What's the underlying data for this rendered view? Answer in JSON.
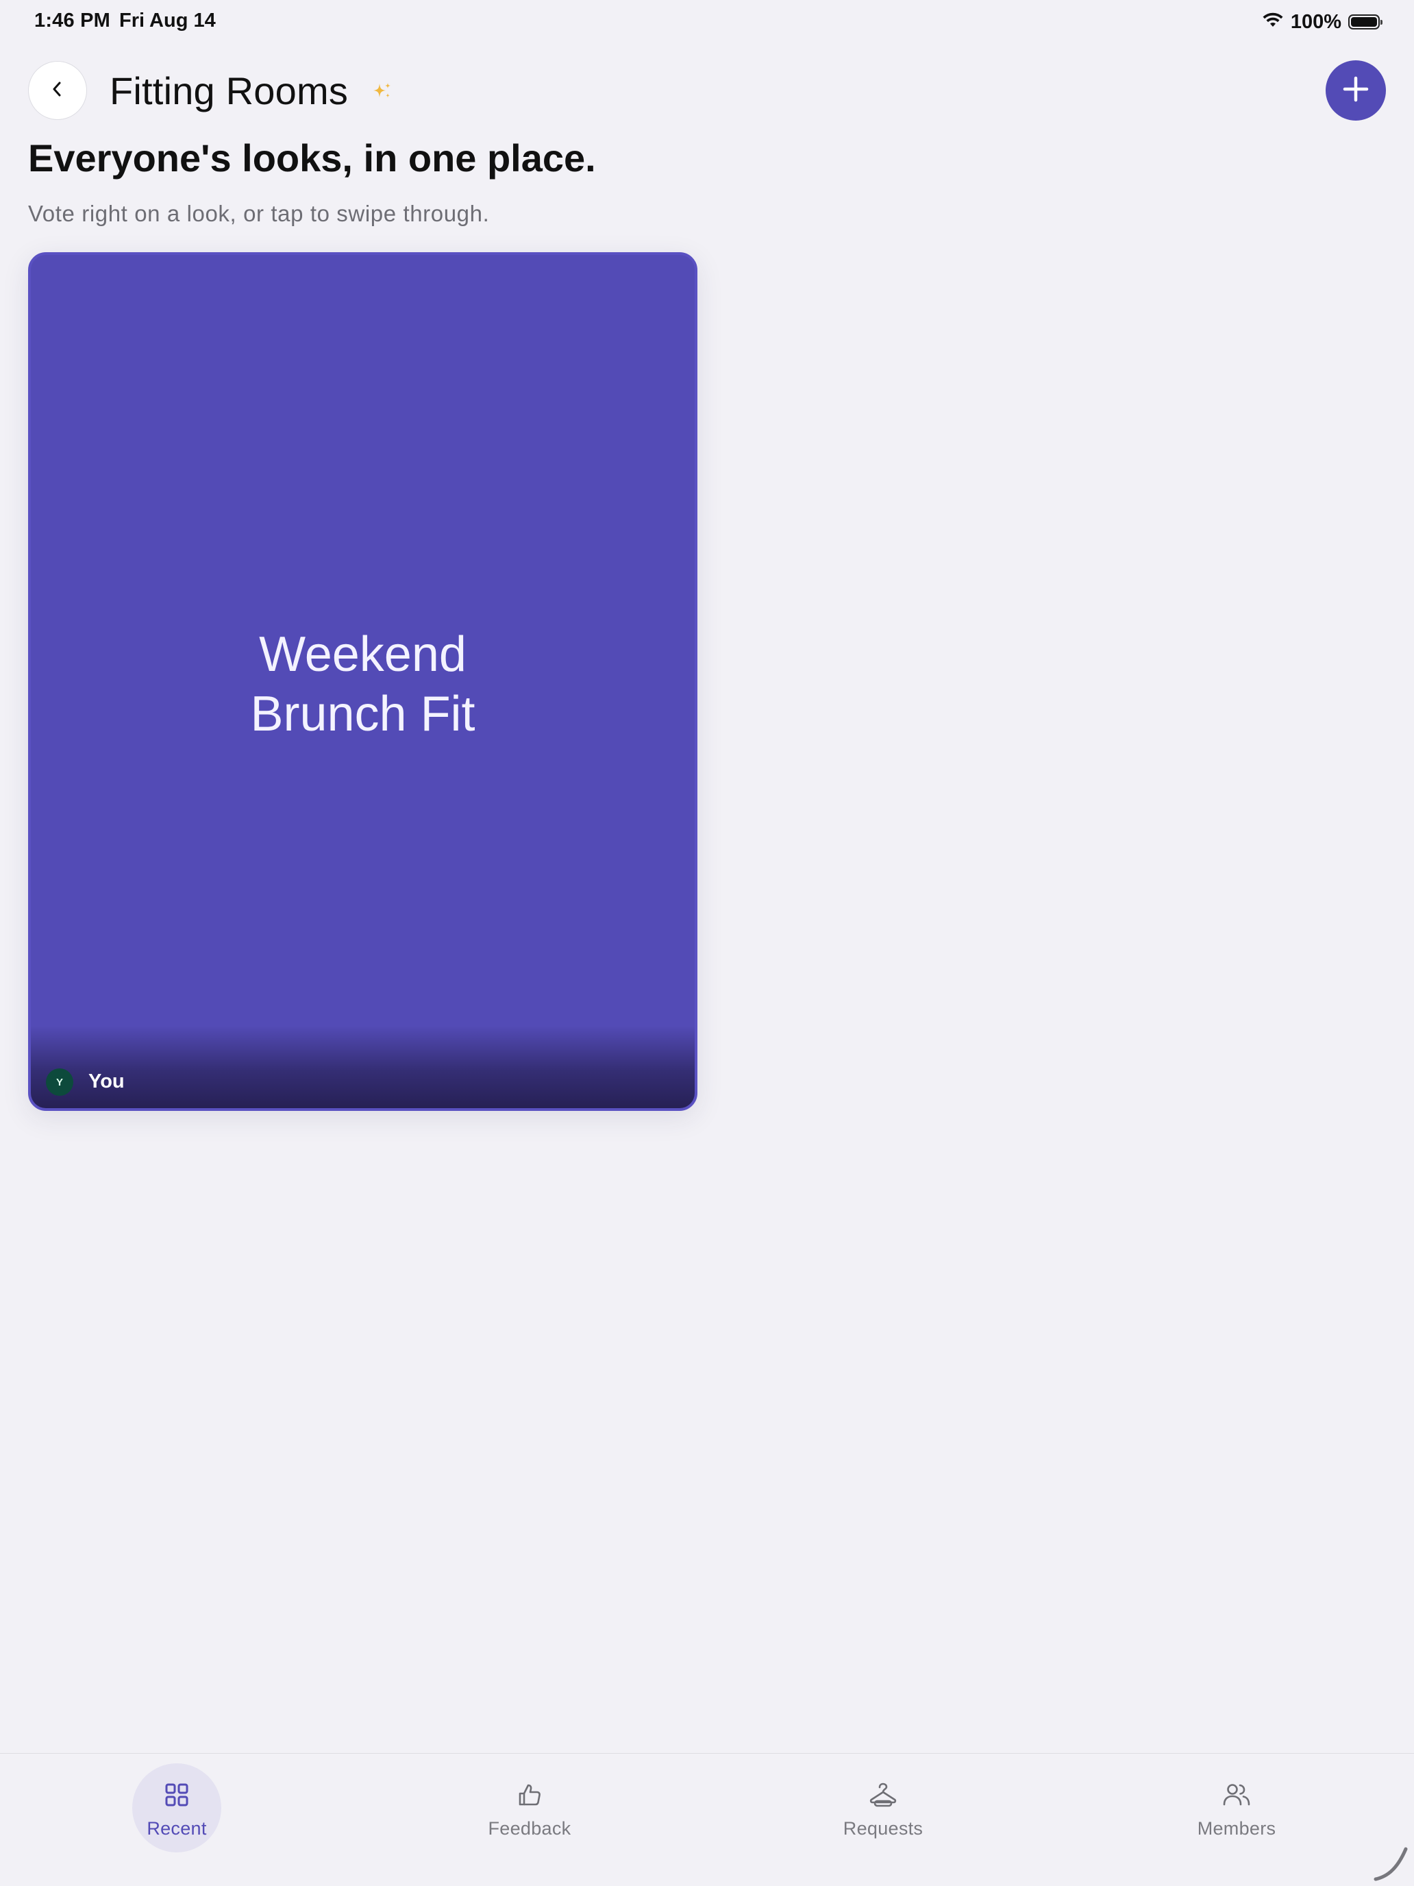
{
  "status_bar": {
    "time": "1:46 PM",
    "date": "Fri Aug 14",
    "battery_percent": "100%",
    "icons": [
      "wifi-icon",
      "battery-icon"
    ]
  },
  "header": {
    "title": "Fitting Rooms",
    "back_icon": "chevron-left-icon",
    "add_icon": "plus-icon",
    "title_decoration_icon": "sparkle-icon"
  },
  "intro": {
    "headline": "Everyone's looks, in one place.",
    "subheadline": "Vote right on a look, or tap to swipe through."
  },
  "looks": [
    {
      "title_line_1": "Weekend",
      "title_line_2": "Brunch Fit",
      "owner_initial": "Y",
      "owner_name": "You",
      "card_color": "#534bb6"
    }
  ],
  "tab_bar": {
    "tabs": [
      {
        "label": "Recent",
        "icon": "grid-icon",
        "active": true
      },
      {
        "label": "Feedback",
        "icon": "thumbs-up-icon",
        "active": false
      },
      {
        "label": "Requests",
        "icon": "hanger-icon",
        "active": false
      },
      {
        "label": "Members",
        "icon": "people-icon",
        "active": false
      }
    ]
  },
  "colors": {
    "accent": "#534bb6",
    "background": "#f2f1f6",
    "sparkle": "#f0b840",
    "inactive_tab": "#7a7a80"
  }
}
